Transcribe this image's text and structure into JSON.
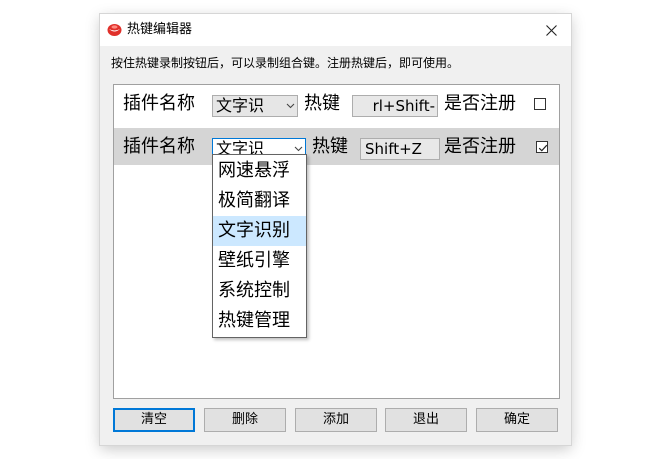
{
  "window": {
    "title": "热键编辑器",
    "instruction": "按住热键录制按钮后，可以录制组合键。注册热键后，即可使用。"
  },
  "rows": [
    {
      "plugin_label": "插件名称",
      "plugin_value": "文字识",
      "hotkey_label": "热键",
      "hotkey_value": "rl+Shift-",
      "register_label": "是否注册",
      "registered": false
    },
    {
      "plugin_label": "插件名称",
      "plugin_value": "文字识",
      "hotkey_label": "热键",
      "hotkey_value": "Shift+Z",
      "register_label": "是否注册",
      "registered": true
    }
  ],
  "dropdown": {
    "options": [
      "网速悬浮",
      "极简翻译",
      "文字识别",
      "壁纸引擎",
      "系统控制",
      "热键管理"
    ],
    "selected": "文字识别"
  },
  "buttons": {
    "clear": "清空",
    "delete": "删除",
    "add": "添加",
    "exit": "退出",
    "ok": "确定"
  },
  "colors": {
    "accent": "#0078d7",
    "selection": "#cce8ff",
    "active_row": "#d5d5d5"
  },
  "icons": [
    "app-logo-icon",
    "close-icon",
    "chevron-down-icon",
    "checkbox-check-icon"
  ]
}
